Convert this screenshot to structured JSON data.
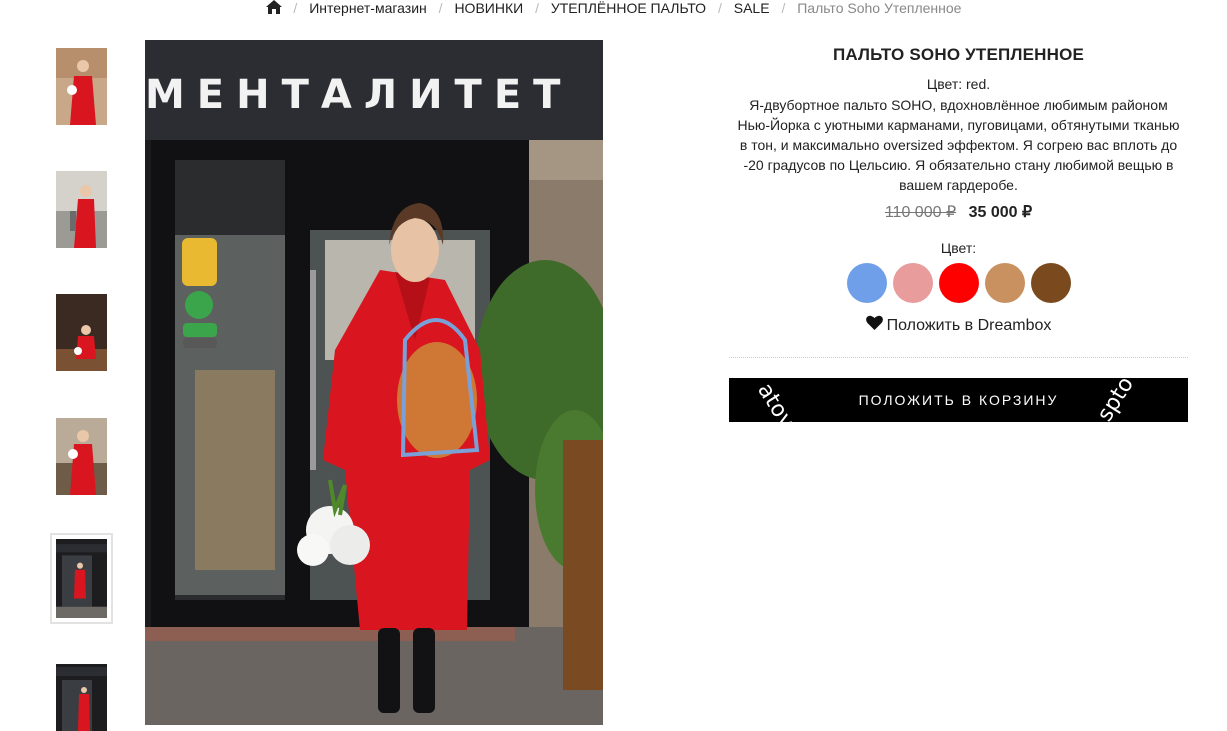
{
  "breadcrumb": {
    "items": [
      "Интернет-магазин",
      "НОВИНКИ",
      "УТЕПЛЁННОЕ ПАЛЬТО",
      "SALE"
    ],
    "current": "Пальто Soho Утепленное"
  },
  "product": {
    "title": "ПАЛЬТО SOHO УТЕПЛЕННОЕ",
    "color_line": "Цвет: red.",
    "description": "Я-двубортное пальто SOHO, вдохновлённое любимым районом Нью-Йорка с уютными карманами, пуговицами, обтянутыми тканью в тон, и максимально oversized эффектом. Я согрею вас вплоть до -20 градусов по Цельсию. Я обязательно стану любимой вещью в вашем гардеробе.",
    "old_price": "110 000 ₽",
    "new_price": "35 000 ₽",
    "color_label": "Цвет:",
    "swatches": [
      "#6f9fe8",
      "#e89c9c",
      "#ff0000",
      "#c8915f",
      "#7a4a1e"
    ],
    "dreambox_label": "Положить в Dreambox",
    "cart_label": "ПОЛОЖИТЬ В КОРЗИНУ",
    "watermark_left": "atov.ru",
    "watermark_right": "sptova"
  },
  "photo": {
    "sign_text": "МЕНТАЛИТЕТ"
  },
  "icons": {
    "home": "home-icon",
    "heart": "heart-icon"
  },
  "colors": {
    "coat": "#d9151f",
    "sign": "#2c2d32",
    "button": "#000000"
  }
}
